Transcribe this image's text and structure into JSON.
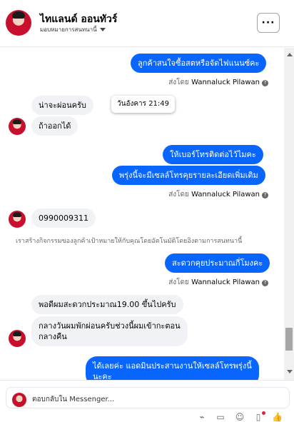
{
  "header": {
    "title": "ไทแลนด์ ออนทัวร์",
    "subtitle": "มอบหมายการสนทนานี้",
    "menu_label": "···"
  },
  "messages": [
    {
      "text": "ลูกค้าสนใจซื้อสตหรือจัดไฟแนนซ์คะ",
      "direction": "out"
    },
    {
      "text": "น่าจะผ่อนครับ",
      "direction": "in"
    },
    {
      "text": "ถ้าออกได้",
      "direction": "in"
    },
    {
      "text": "ให้เบอร์โทรติดต่อไว้ไมคะ",
      "direction": "out"
    },
    {
      "text": "พรุ่งนี้จะมีเซลล์โทรคุยรายละเอียดเพิ่มเติม",
      "direction": "out"
    },
    {
      "text": "0990009311",
      "direction": "in"
    },
    {
      "text": "สะดวกคุยประมาณกี่โมงคะ",
      "direction": "out"
    },
    {
      "text": "พอดีผมสะดวกประมาณ19.00 ขึ้นไปครับ",
      "direction": "in"
    },
    {
      "text_line1": "กลางวันผมพักผ่อนครับช่วงนี้ผมเข้ากะตอน",
      "text_line2": "กลางคืน",
      "direction": "in"
    },
    {
      "text_line1": "ได้เลยค่ะ แอดมินประสานงานให้เซลล์โทรพรุ่งนี้",
      "text_line2": "นะคะ",
      "direction": "out"
    }
  ],
  "sent_by": {
    "prefix": "ส่งโดย",
    "name": "Wannaluck Pilawan",
    "info_icon": "?"
  },
  "notice": "เราสร้างกิจกรรมของลูกค้าเป้าหมายให้กับคุณโดยอัตโนมัติโดยอิงตามการสนทนานี้",
  "tooltip": "วันอังคาร 21:49",
  "composer": {
    "placeholder": "ตอบกลับใน Messenger...",
    "tools": [
      {
        "icon": "attachment-icon",
        "glyph": "⌁"
      },
      {
        "icon": "saved-reply-icon",
        "glyph": "▭"
      },
      {
        "icon": "emoji-icon",
        "glyph": "☺"
      },
      {
        "icon": "gif-icon",
        "glyph": "▯"
      },
      {
        "icon": "like-icon",
        "glyph": "👍"
      }
    ]
  },
  "colors": {
    "accent": "#0866ff",
    "incoming": "#f0f2f5",
    "notification_dot": "#e41e3f"
  }
}
